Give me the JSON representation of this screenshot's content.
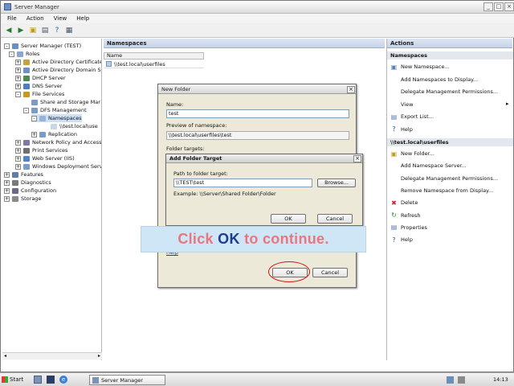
{
  "window": {
    "title": "Server Manager"
  },
  "menu": [
    "File",
    "Action",
    "View",
    "Help"
  ],
  "tree": {
    "items": [
      {
        "label": "Server Manager (TEST)",
        "exp": "-"
      },
      {
        "label": "Roles",
        "exp": "-"
      },
      {
        "label": "Active Directory Certificate",
        "exp": "+"
      },
      {
        "label": "Active Directory Domain Se",
        "exp": "+"
      },
      {
        "label": "DHCP Server",
        "exp": "+"
      },
      {
        "label": "DNS Server",
        "exp": "+"
      },
      {
        "label": "File Services",
        "exp": "-"
      },
      {
        "label": "Share and Storage Mar",
        "exp": ""
      },
      {
        "label": "DFS Management",
        "exp": "-"
      },
      {
        "label": "Namespaces",
        "exp": "-"
      },
      {
        "label": "\\\\test.local\\use",
        "exp": ""
      },
      {
        "label": "Replication",
        "exp": "+"
      },
      {
        "label": "Network Policy and Access",
        "exp": "+"
      },
      {
        "label": "Print Services",
        "exp": "+"
      },
      {
        "label": "Web Server (IIS)",
        "exp": "+"
      },
      {
        "label": "Windows Deployment Servi",
        "exp": "+"
      },
      {
        "label": "Features",
        "exp": "+"
      },
      {
        "label": "Diagnostics",
        "exp": "+"
      },
      {
        "label": "Configuration",
        "exp": "+"
      },
      {
        "label": "Storage",
        "exp": "+"
      }
    ]
  },
  "center": {
    "header": "Namespaces",
    "column": "Name",
    "row": "\\\\test.local\\userfiles"
  },
  "actions": {
    "header": "Actions",
    "section1": "Namespaces",
    "items1": [
      "New Namespace...",
      "Add Namespaces to Display...",
      "Delegate Management Permissions...",
      "View",
      "Export List...",
      "Help"
    ],
    "section2": "\\\\test.local\\userfiles",
    "items2": [
      "New Folder...",
      "Add Namespace Server...",
      "Delegate Management Permissions...",
      "Remove Namespace from Display...",
      "Delete",
      "Refresh",
      "Properties",
      "Help"
    ]
  },
  "new_folder_dialog": {
    "title": "New Folder",
    "name_label": "Name:",
    "name_value": "test",
    "preview_label": "Preview of namespace:",
    "preview_value": "\\\\test.local\\userfiles\\test",
    "targets_label": "Folder targets:",
    "help_link": "Help",
    "ok": "OK",
    "cancel": "Cancel"
  },
  "add_target_dialog": {
    "title": "Add Folder Target",
    "path_label": "Path to folder target:",
    "path_value": "\\\\TEST\\test",
    "browse": "Browse...",
    "example": "Example: \\\\Server\\Shared Folder\\Folder",
    "ok": "OK",
    "cancel": "Cancel"
  },
  "banner": {
    "pre": "Click ",
    "ok": "OK",
    "post": " to continue."
  },
  "taskbar": {
    "start": "Start",
    "app": "Server Manager",
    "clock": "14:13"
  },
  "colors": {
    "banner_text": "#e9767f",
    "banner_ok": "#1c3c8c",
    "banner_bg": "#cfe6f7",
    "highlight_circle": "#d01010"
  }
}
